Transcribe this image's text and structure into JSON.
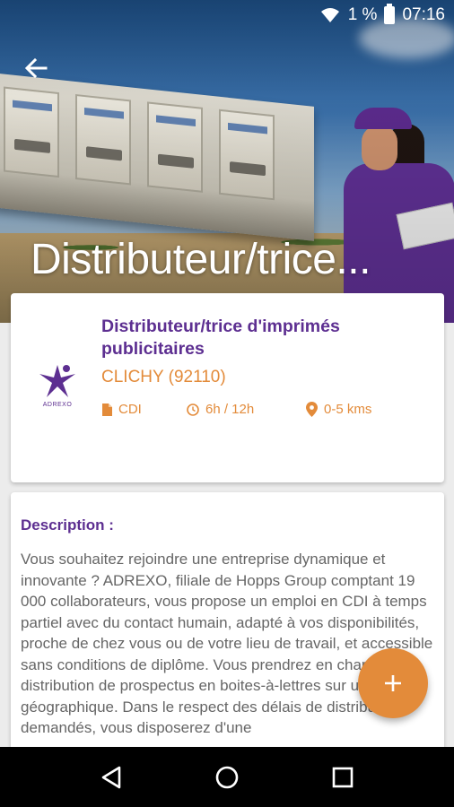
{
  "status_bar": {
    "battery": "1 %",
    "time": "07:16",
    "icons": [
      "wifi-icon",
      "battery-icon"
    ]
  },
  "header": {
    "title": "Distributeur/trice...",
    "back_icon": "arrow-left-icon"
  },
  "job": {
    "title": "Distributeur/trice d'imprimés publicitaires",
    "location": "CLICHY (92110)",
    "company_logo_text": "ADREXO",
    "meta": [
      {
        "icon": "document-icon",
        "label": "CDI"
      },
      {
        "icon": "clock-icon",
        "label": "6h / 12h"
      },
      {
        "icon": "location-pin-icon",
        "label": "0-5 kms"
      }
    ]
  },
  "description": {
    "heading": "Description :",
    "text": "Vous souhaitez rejoindre une entreprise dynamique et innovante ? ADREXO, filiale de Hopps Group comptant 19 000 collaborateurs, vous propose un emploi en CDI à temps partiel avec du contact humain, adapté à vos disponibilités, proche de chez vous ou de votre lieu de travail, et accessible sans conditions de diplôme. Vous prendrez en charge la distribution de prospectus en boites-à-lettres sur un secteur géographique. Dans le respect des délais de distribution demandés, vous disposerez d'une"
  },
  "fab": {
    "icon": "plus-icon"
  },
  "colors": {
    "primary": "#5d2f91",
    "accent": "#e38b3a",
    "text": "#666666",
    "background": "#ececec"
  },
  "nav_bar": {
    "icons": [
      "back-triangle-icon",
      "home-circle-icon",
      "recents-square-icon"
    ]
  }
}
